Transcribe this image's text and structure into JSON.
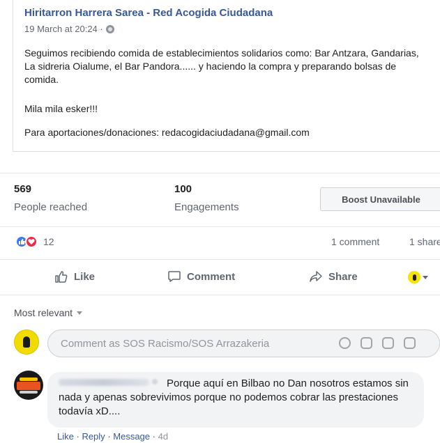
{
  "shared_post": {
    "page_name": "Hiritarron Harrera Sarea - Red Acogida Ciudadana",
    "date": "19 March at 20:24 ·",
    "paragraph1": "Seguimos recibiendo comida de establecimientos solidarios como: Bar Antzara, Gandarias, La sidreria Oialume, el Bar Pandora...... y haciendo la compra y preparando bolsas de comida.",
    "paragraph2": "Mila mila esker!!!",
    "paragraph3": "Para aportaciones/donaciones: redacogidaciudadana@gmail.com"
  },
  "insights": {
    "reached_value": "569",
    "reached_label": "People reached",
    "engagements_value": "100",
    "engagements_label": "Engagements",
    "boost_label": "Boost Unavailable"
  },
  "reactions": {
    "count": "12",
    "comments": "1 comment",
    "shares": "1 share",
    "icons": [
      "like-reaction-icon",
      "love-reaction-icon"
    ]
  },
  "actions": {
    "like": "Like",
    "comment": "Comment",
    "share": "Share"
  },
  "comments": {
    "sort_label": "Most relevant",
    "input_placeholder": "Comment as SOS Racismo/SOS Arrazakeria",
    "items": [
      {
        "text": "Porque aquí en Bilbao no Dan nosotros estamos sin nada y apenas sobrevivimos porque no podemos cobrar las prestaciones todavía xD....",
        "like": "Like",
        "reply": "Reply",
        "message": "Message",
        "time": "4d"
      }
    ]
  },
  "colors": {
    "link_blue": "#385898",
    "like_blue": "#3b7bf5",
    "love_red": "#f0284a",
    "page_avatar_yellow": "#f2dc00"
  }
}
